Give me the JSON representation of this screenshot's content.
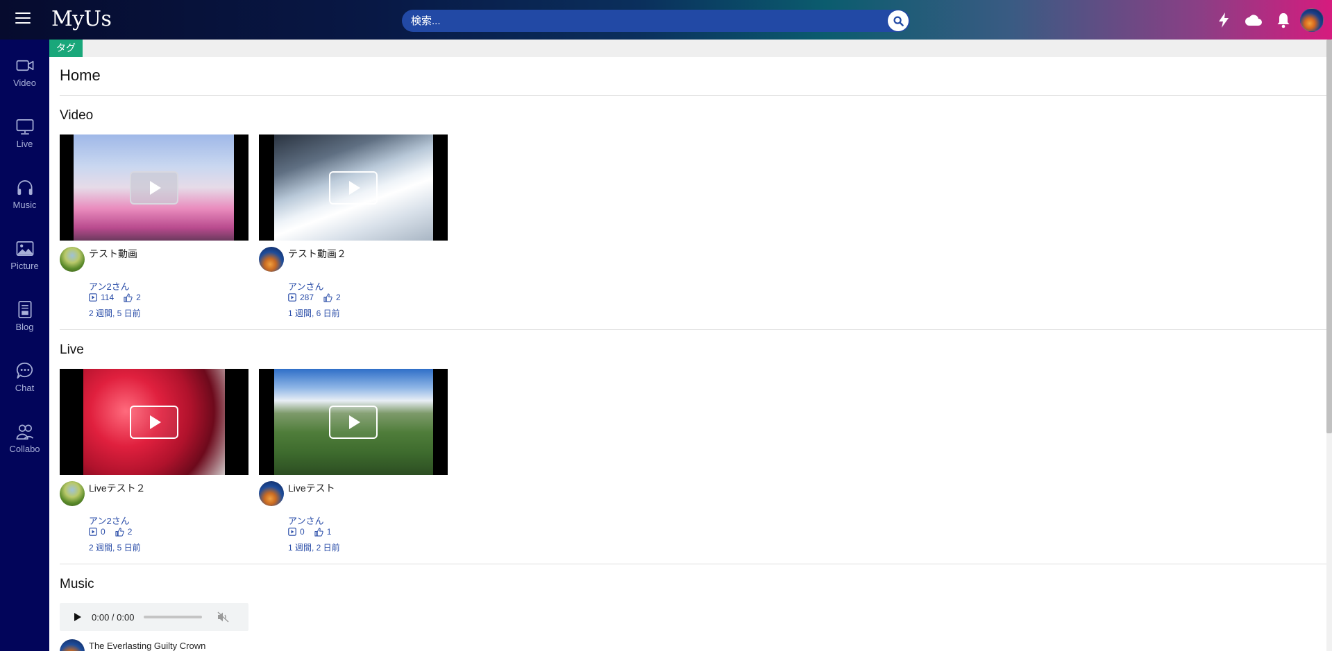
{
  "app": {
    "logo": "MyUs"
  },
  "search": {
    "placeholder": "検索..."
  },
  "sidebar": {
    "items": [
      {
        "label": "Video",
        "icon": "video-camera-icon"
      },
      {
        "label": "Live",
        "icon": "monitor-icon"
      },
      {
        "label": "Music",
        "icon": "headphones-icon"
      },
      {
        "label": "Picture",
        "icon": "image-icon"
      },
      {
        "label": "Blog",
        "icon": "document-icon"
      },
      {
        "label": "Chat",
        "icon": "chat-bubble-icon"
      },
      {
        "label": "Collabo",
        "icon": "people-icon"
      }
    ]
  },
  "header_icons": [
    "lightning-icon",
    "cloud-icon",
    "bell-icon",
    "user-avatar"
  ],
  "tag": {
    "label": "タグ"
  },
  "page": {
    "title": "Home"
  },
  "sections": {
    "video": {
      "title": "Video",
      "cards": [
        {
          "title": "テスト動画",
          "user": "アン2さん",
          "views": "114",
          "likes": "2",
          "date": "2 週間, 5 日前"
        },
        {
          "title": "テスト動画２",
          "user": "アンさん",
          "views": "287",
          "likes": "2",
          "date": "1 週間, 6 日前"
        }
      ]
    },
    "live": {
      "title": "Live",
      "cards": [
        {
          "title": "Liveテスト２",
          "user": "アン2さん",
          "views": "0",
          "likes": "2",
          "date": "2 週間, 5 日前"
        },
        {
          "title": "Liveテスト",
          "user": "アンさん",
          "views": "0",
          "likes": "1",
          "date": "1 週間, 2 日前"
        }
      ]
    },
    "music": {
      "title": "Music",
      "player": {
        "time": "0:00 / 0:00"
      },
      "track": {
        "title": "The Everlasting Guilty Crown"
      }
    }
  },
  "colors": {
    "sidebar_bg": "#02055a",
    "search_bg": "#2249a5",
    "tag_bg": "#19a77a",
    "link": "#2a4da8"
  }
}
